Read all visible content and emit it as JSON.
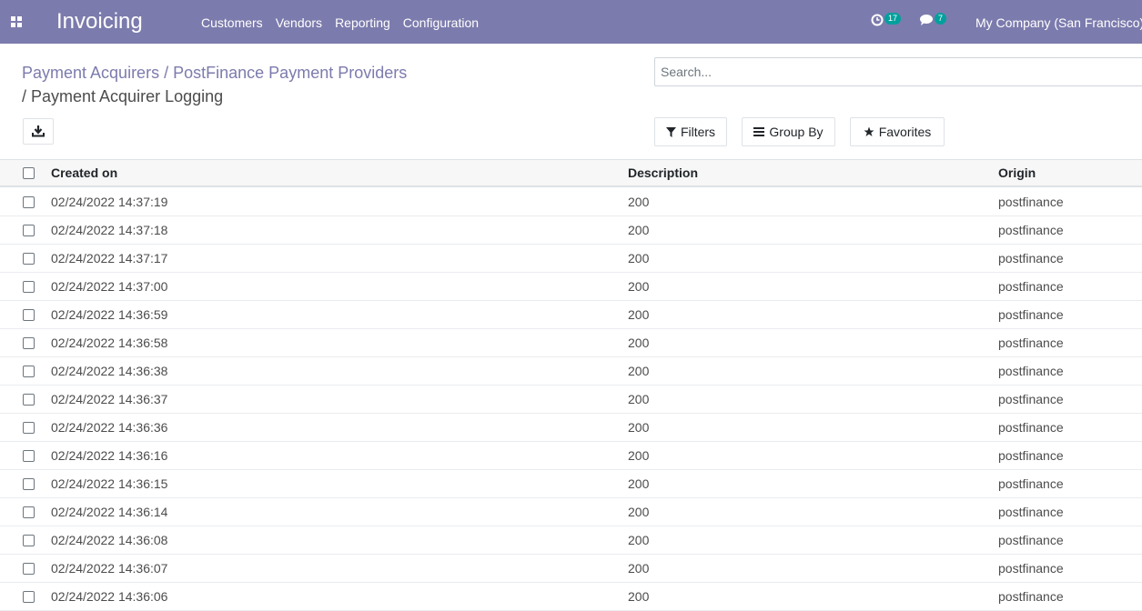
{
  "navbar": {
    "app_name": "Invoicing",
    "menu": [
      "Customers",
      "Vendors",
      "Reporting",
      "Configuration"
    ],
    "activity_count": "17",
    "messages_count": "7",
    "company": "My Company (San Francisco)",
    "bg_color": "#7c7bad",
    "badge_color": "#00a09d"
  },
  "breadcrumb": {
    "item1": "Payment Acquirers",
    "sep": "/",
    "item2": "PostFinance Payment Providers",
    "current": "/ Payment Acquirer Logging"
  },
  "search": {
    "placeholder": "Search..."
  },
  "filters": {
    "filters_label": "Filters",
    "group_by_label": "Group By",
    "favorites_label": "Favorites"
  },
  "table": {
    "columns": [
      "Created on",
      "Description",
      "Origin"
    ],
    "rows": [
      [
        "02/24/2022 14:37:19",
        "200",
        "postfinance"
      ],
      [
        "02/24/2022 14:37:18",
        "200",
        "postfinance"
      ],
      [
        "02/24/2022 14:37:17",
        "200",
        "postfinance"
      ],
      [
        "02/24/2022 14:37:00",
        "200",
        "postfinance"
      ],
      [
        "02/24/2022 14:36:59",
        "200",
        "postfinance"
      ],
      [
        "02/24/2022 14:36:58",
        "200",
        "postfinance"
      ],
      [
        "02/24/2022 14:36:38",
        "200",
        "postfinance"
      ],
      [
        "02/24/2022 14:36:37",
        "200",
        "postfinance"
      ],
      [
        "02/24/2022 14:36:36",
        "200",
        "postfinance"
      ],
      [
        "02/24/2022 14:36:16",
        "200",
        "postfinance"
      ],
      [
        "02/24/2022 14:36:15",
        "200",
        "postfinance"
      ],
      [
        "02/24/2022 14:36:14",
        "200",
        "postfinance"
      ],
      [
        "02/24/2022 14:36:08",
        "200",
        "postfinance"
      ],
      [
        "02/24/2022 14:36:07",
        "200",
        "postfinance"
      ],
      [
        "02/24/2022 14:36:06",
        "200",
        "postfinance"
      ]
    ]
  }
}
